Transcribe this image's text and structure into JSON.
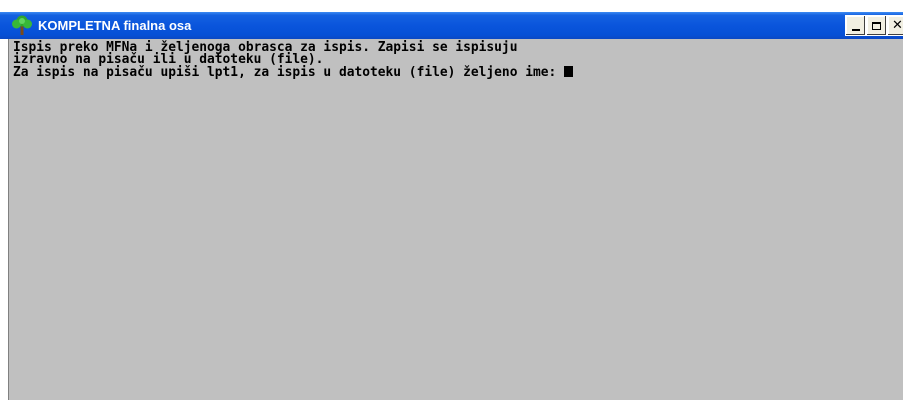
{
  "window": {
    "title": "KOMPLETNA finalna osa",
    "icon": "tree-icon",
    "controls": {
      "minimize": "minimize-icon",
      "maximize": "maximize-icon",
      "close": "close-icon"
    }
  },
  "console": {
    "lines": [
      "Ispis preko MFNa i željenoga obrasca za ispis. Zapisi se ispisuju",
      "izravno na pisaču ili u datoteku (file).",
      "Za ispis na pisaču upiši lpt1, za ispis u datoteku (file) željeno ime: "
    ],
    "background": "#c0c0c0",
    "text_color": "#000000"
  },
  "colors": {
    "titlebar": "#0a55dc",
    "title_text": "#ffffff"
  }
}
